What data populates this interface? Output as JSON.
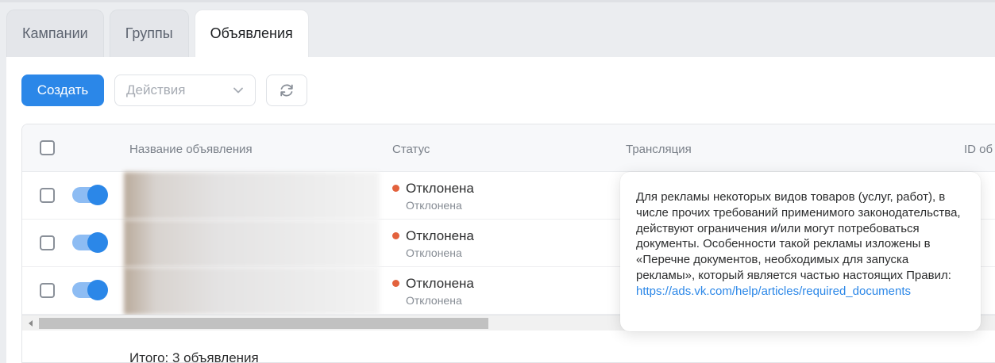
{
  "tabs": [
    {
      "label": "Кампании",
      "active": false
    },
    {
      "label": "Группы",
      "active": false
    },
    {
      "label": "Объявления",
      "active": true
    }
  ],
  "toolbar": {
    "create_label": "Создать",
    "actions_placeholder": "Действия",
    "refresh_icon": "refresh-icon"
  },
  "table": {
    "columns": [
      "Название объявления",
      "Статус",
      "Трансляция",
      "ID об"
    ],
    "rows": [
      {
        "enabled": true,
        "status": "Отклонена",
        "status_sub": "Отклонена"
      },
      {
        "enabled": true,
        "status": "Отклонена",
        "status_sub": "Отклонена"
      },
      {
        "enabled": true,
        "status": "Отклонена",
        "status_sub": "Отклонена"
      }
    ]
  },
  "footer": {
    "total": "Итого: 3 объявления"
  },
  "tooltip": {
    "text": "Для рекламы некоторых видов товаров (услуг, работ), в числе прочих требований применимого законодательства, действуют ограничения и/или могут потребоваться документы. Особенности такой рекламы изложены в «Перечне документов, необходимых для запуска рекламы», который является частью настоящих Правил:",
    "link": "https://ads.vk.com/help/articles/required_documents"
  },
  "colors": {
    "accent": "#2b87e8",
    "status_rejected": "#e3623d"
  }
}
